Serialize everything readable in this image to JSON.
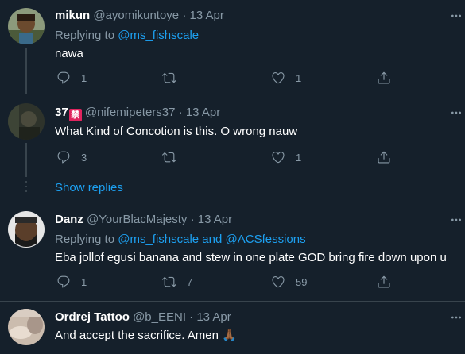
{
  "tweets": [
    {
      "name": "mikun",
      "handle": "@ayomikuntoye",
      "date": "13 Apr",
      "replying_prefix": "Replying to",
      "replying_to": "@ms_fishscale",
      "text": "nawa",
      "replies": "1",
      "retweets": "",
      "likes": "1",
      "avatar_color": "#7a8a6a"
    },
    {
      "name": "37",
      "badge": "禁",
      "handle": "@nifemipeters37",
      "date": "13 Apr",
      "text": "What Kind of Concotion is this. O wrong nauw",
      "replies": "3",
      "retweets": "",
      "likes": "1",
      "avatar_color": "#3a3f36"
    },
    {
      "name": "Danz",
      "handle": "@YourBlacMajesty",
      "date": "13 Apr",
      "replying_prefix": "Replying to",
      "replying_to": "@ms_fishscale and @ACSfessions",
      "text": "Eba jollof egusi banana and stew in one plate GOD bring fire down upon u",
      "replies": "1",
      "retweets": "7",
      "likes": "59",
      "avatar_color": "#5a4632"
    },
    {
      "name": "Ordrej Tattoo",
      "handle": "@b_EENI",
      "date": "13 Apr",
      "text": "And accept the sacrifice. Amen 🙏🏾",
      "avatar_color": "#c9b8a8"
    }
  ],
  "dot": "·",
  "show_replies": "Show replies",
  "icons": {
    "reply": "reply-icon",
    "retweet": "retweet-icon",
    "like": "like-icon",
    "share": "share-icon",
    "more": "more-icon"
  },
  "colors": {
    "background": "#15202b",
    "border": "#38444d",
    "secondary_text": "#8899a6",
    "link": "#1da1f2"
  }
}
